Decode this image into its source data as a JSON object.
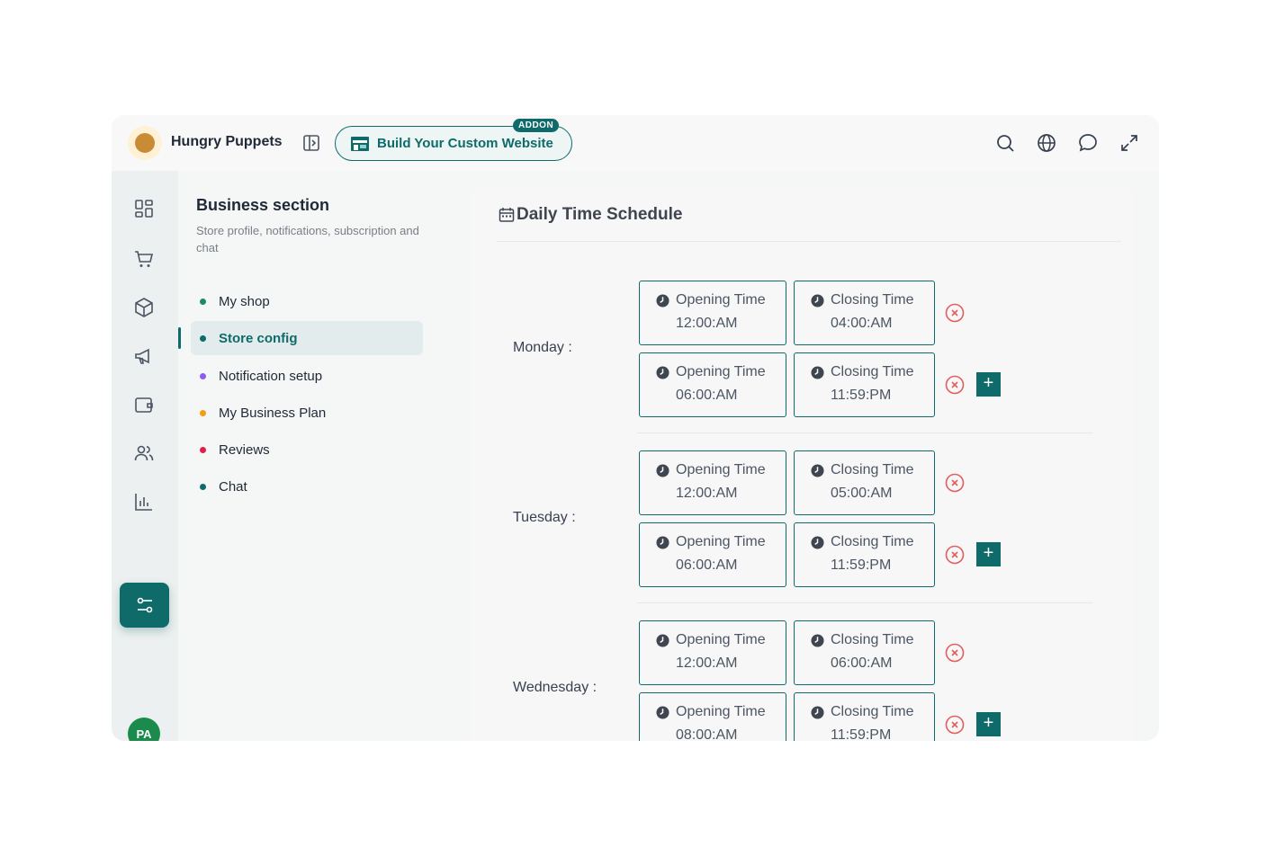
{
  "header": {
    "brand": "Hungry Puppets",
    "website_button": "Build Your Custom Website",
    "addon_badge": "ADDON",
    "icons": [
      "search-icon",
      "globe-icon",
      "chat-bubble-icon",
      "expand-icon"
    ]
  },
  "rail": {
    "items": [
      "dashboard-icon",
      "cart-icon",
      "box-icon",
      "megaphone-icon",
      "wallet-icon",
      "users-icon",
      "chart-icon",
      "settings-sliders-icon"
    ],
    "active": "settings-sliders-icon",
    "avatar": "PA"
  },
  "menu": {
    "title": "Business section",
    "subtitle": "Store profile, notifications, subscription and chat",
    "items": [
      {
        "label": "My shop",
        "color": "#1a8a6e"
      },
      {
        "label": "Store config",
        "color": "#0f6a6a",
        "active": true
      },
      {
        "label": "Notification setup",
        "color": "#8b5cf6"
      },
      {
        "label": "My Business Plan",
        "color": "#f59e0b"
      },
      {
        "label": "Reviews",
        "color": "#e11d48"
      },
      {
        "label": "Chat",
        "color": "#0f6a6a"
      }
    ]
  },
  "schedule": {
    "title": "Daily Time Schedule",
    "opening_label": "Opening Time",
    "closing_label": "Closing Time",
    "days": [
      {
        "label": "Monday :",
        "slots": [
          {
            "open": "12:00:AM",
            "close": "04:00:AM"
          },
          {
            "open": "06:00:AM",
            "close": "11:59:PM"
          }
        ]
      },
      {
        "label": "Tuesday :",
        "slots": [
          {
            "open": "12:00:AM",
            "close": "05:00:AM"
          },
          {
            "open": "06:00:AM",
            "close": "11:59:PM"
          }
        ]
      },
      {
        "label": "Wednesday :",
        "slots": [
          {
            "open": "12:00:AM",
            "close": "06:00:AM"
          },
          {
            "open": "08:00:AM",
            "close": "11:59:PM"
          }
        ]
      }
    ],
    "add_symbol": "+"
  },
  "colors": {
    "accent": "#0f6a6a",
    "remove": "#e35d5d"
  }
}
